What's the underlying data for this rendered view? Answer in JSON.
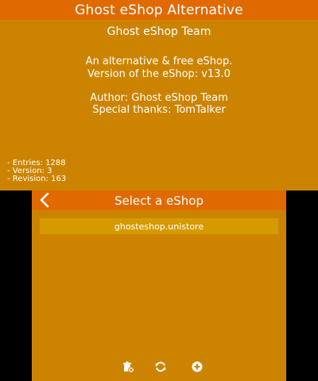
{
  "top": {
    "header_title": "Ghost eShop Alternative",
    "store_title": "Ghost eShop Team",
    "description_line1": "An alternative & free eShop.",
    "description_line2": "Version of the eShop: v13.0",
    "author_line": "Author: Ghost eShop Team",
    "thanks_line": "Special thanks: TomTalker",
    "meta": {
      "entries": "- Entries: 1288",
      "version": "- Version: 3",
      "revision": "- Revision: 163"
    }
  },
  "bottom": {
    "header_title": "Select a eShop",
    "items": [
      {
        "label": "ghosteshop.unistore"
      }
    ],
    "toolbar": {
      "icons": [
        "delete-icon",
        "refresh-icon",
        "add-icon"
      ]
    }
  },
  "colors": {
    "background": "#cc8400",
    "header": "#e06a00",
    "list_item": "#d59a00",
    "text": "#ffffff"
  }
}
